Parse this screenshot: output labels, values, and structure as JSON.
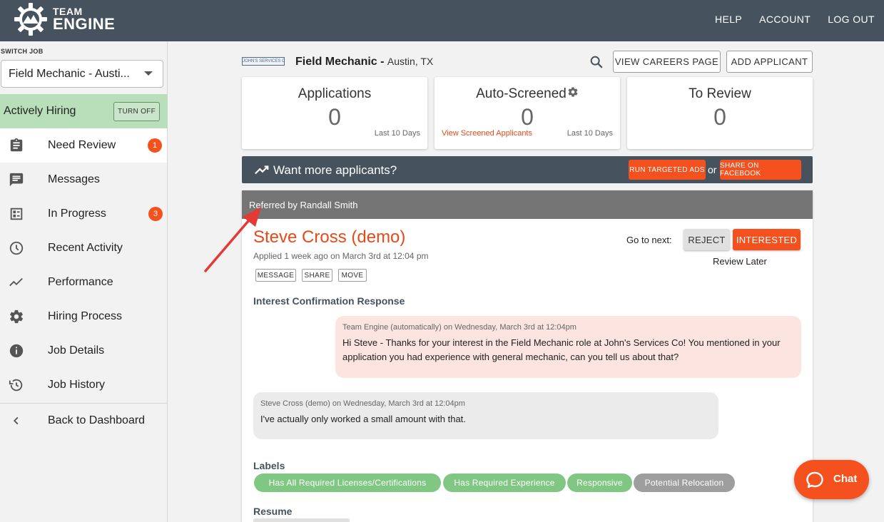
{
  "brand": {
    "line1": "TEAM",
    "line2": "ENGINE"
  },
  "topnav": {
    "help": "HELP",
    "account": "ACCOUNT",
    "logout": "LOG OUT"
  },
  "sidebar": {
    "switch_label": "SWITCH JOB",
    "selected_job": "Field Mechanic - Austi...",
    "status": "Actively Hiring",
    "turn_off": "TURN OFF",
    "items": [
      {
        "label": "Need Review",
        "icon": "clipboard-icon",
        "badge": "1"
      },
      {
        "label": "Messages",
        "icon": "message-icon"
      },
      {
        "label": "In Progress",
        "icon": "checklist-icon",
        "badge": "3"
      },
      {
        "label": "Recent Activity",
        "icon": "clock-icon"
      },
      {
        "label": "Performance",
        "icon": "trending-icon"
      },
      {
        "label": "Hiring Process",
        "icon": "gear-icon"
      },
      {
        "label": "Job Details",
        "icon": "info-icon"
      },
      {
        "label": "Job History",
        "icon": "history-icon"
      },
      {
        "label": "Back to Dashboard",
        "icon": "chevron-left-icon"
      }
    ]
  },
  "job": {
    "company_logo": "JOHN'S SERVICES CO",
    "title": "Field Mechanic - ",
    "location": "Austin, TX",
    "view_careers": "VIEW CAREERS PAGE",
    "add_applicant": "ADD APPLICANT"
  },
  "stats": {
    "applications": {
      "title": "Applications",
      "value": "0",
      "sub": "Last 10 Days"
    },
    "auto_screened": {
      "title": "Auto-Screened",
      "value": "0",
      "link": "View Screened Applicants",
      "sub": "Last 10 Days"
    },
    "to_review": {
      "title": "To Review",
      "value": "0"
    }
  },
  "promo": {
    "text": "Want more applicants?",
    "run_ads": "RUN TARGETED ADS",
    "or": "or",
    "share_fb": "SHARE ON FACEBOOK"
  },
  "applicant": {
    "referred_by": "Referred by Randall Smith",
    "name": "Steve Cross (demo)",
    "applied": "Applied 1 week ago on March 3rd at 12:04 pm",
    "actions": {
      "message": "MESSAGE",
      "share": "SHARE",
      "move": "MOVE"
    },
    "go_to_next": "Go to next:",
    "reject": "REJECT",
    "interested": "INTERESTED",
    "review_later": "Review Later",
    "section_interest": "Interest Confirmation Response",
    "messages": [
      {
        "meta": "Team Engine (automatically) on Wednesday, March 3rd at 12:04pm",
        "text": "Hi Steve - Thanks for your interest in the Field Mechanic role at John's Services Co! You mentioned in your application you had experience with general mechanic, can you tell us about that?"
      },
      {
        "meta": "Steve Cross (demo) on Wednesday, March 3rd at 12:04pm",
        "text": "I've actually only worked a small amount with that."
      }
    ],
    "section_labels": "Labels",
    "labels": [
      "Has All Required Licenses/Certifications",
      "Has Required Experience",
      "Responsive",
      "Potential Relocation"
    ],
    "section_resume": "Resume"
  },
  "chat": {
    "label": "Chat"
  },
  "colors": {
    "header": "#46535e",
    "accent": "#f4511e",
    "hiring_bg": "#b9dfba",
    "label_green": "#81c784",
    "label_grey": "#9e9e9e",
    "annotation_arrow": "#e53935"
  }
}
